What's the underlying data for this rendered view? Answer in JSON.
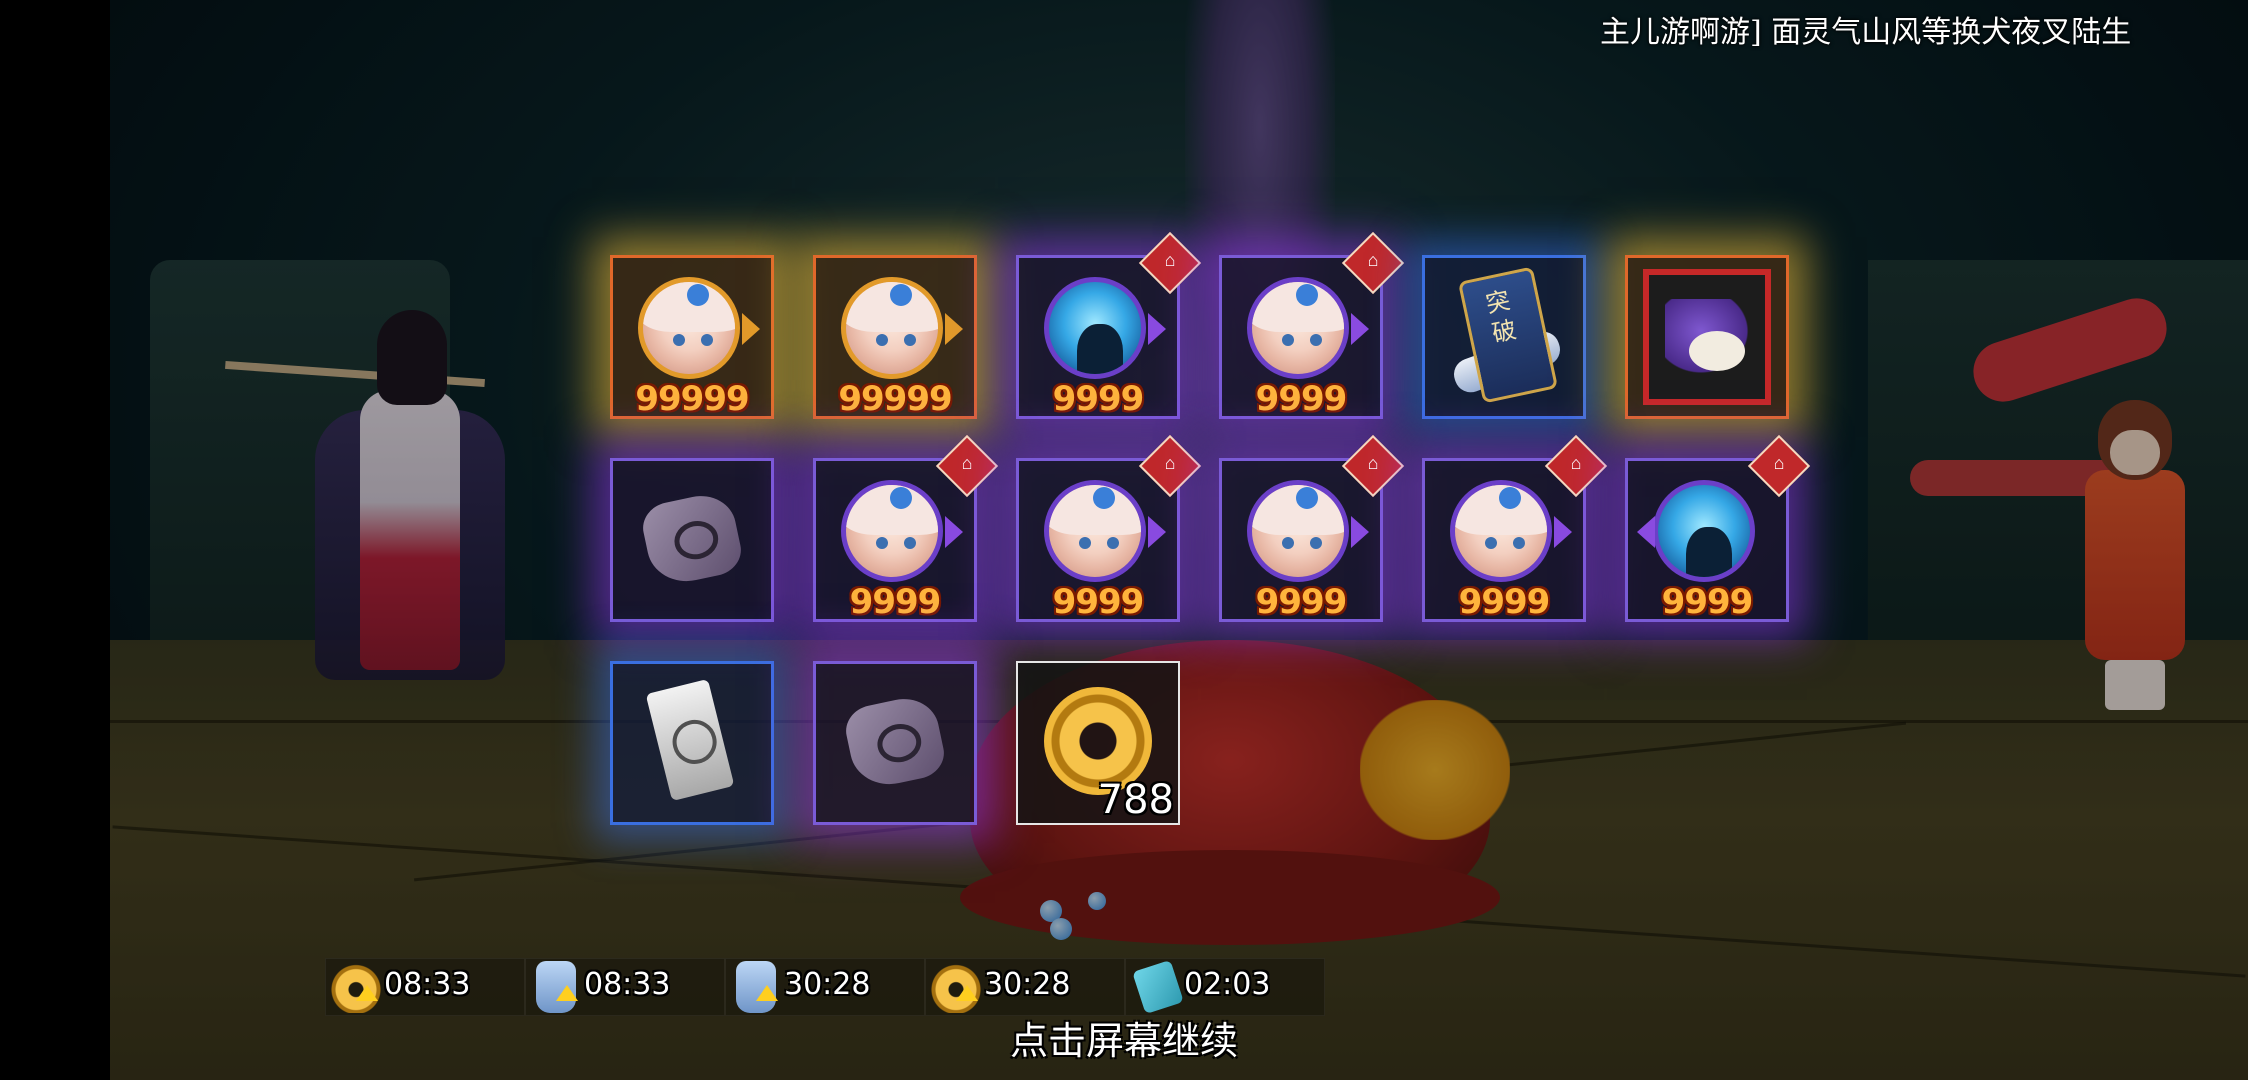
{
  "announcement": "主儿游啊游] 面灵气山风等换犬夜叉陆生",
  "rewards": {
    "row1": [
      {
        "icon": "rabbit-girl-portrait",
        "rarity": "gold",
        "qty": "99999"
      },
      {
        "icon": "rabbit-girl-portrait",
        "rarity": "gold",
        "qty": "99999"
      },
      {
        "icon": "blue-spirit-portrait",
        "rarity": "purple",
        "qty": "9999"
      },
      {
        "icon": "rabbit-girl-portrait",
        "rarity": "purple",
        "qty": "9999"
      },
      {
        "icon": "breakthrough-card",
        "rarity": "blue",
        "label": "突破"
      },
      {
        "icon": "dragon-card",
        "rarity": "gold"
      }
    ],
    "row2": [
      {
        "icon": "bundle",
        "rarity": "purple"
      },
      {
        "icon": "rabbit-girl-portrait",
        "rarity": "purple",
        "qty": "9999"
      },
      {
        "icon": "rabbit-girl-portrait",
        "rarity": "purple",
        "qty": "9999"
      },
      {
        "icon": "rabbit-girl-portrait",
        "rarity": "purple",
        "qty": "9999"
      },
      {
        "icon": "rabbit-girl-portrait",
        "rarity": "purple",
        "qty": "9999"
      },
      {
        "icon": "blue-spirit-portrait",
        "rarity": "purple",
        "qty": "9999"
      }
    ],
    "row3": [
      {
        "icon": "talisman",
        "rarity": "blue"
      },
      {
        "icon": "bundle",
        "rarity": "purple"
      },
      {
        "icon": "coin",
        "rarity": "plain",
        "qty": "788"
      }
    ]
  },
  "timers": [
    {
      "icon": "coin-boost-icon",
      "time": "08:33"
    },
    {
      "icon": "jar-boost-icon",
      "time": "08:33"
    },
    {
      "icon": "jar-boost-icon",
      "time": "30:28"
    },
    {
      "icon": "coin-boost-icon",
      "time": "30:28"
    },
    {
      "icon": "ticket-icon",
      "time": "02:03"
    }
  ],
  "continue_text": "点击屏幕继续",
  "colors": {
    "gold_glow": "#ffc83c",
    "purple_glow": "#a03cff",
    "blue_glow": "#3c78ff",
    "qty_text": "#ffb43c"
  }
}
